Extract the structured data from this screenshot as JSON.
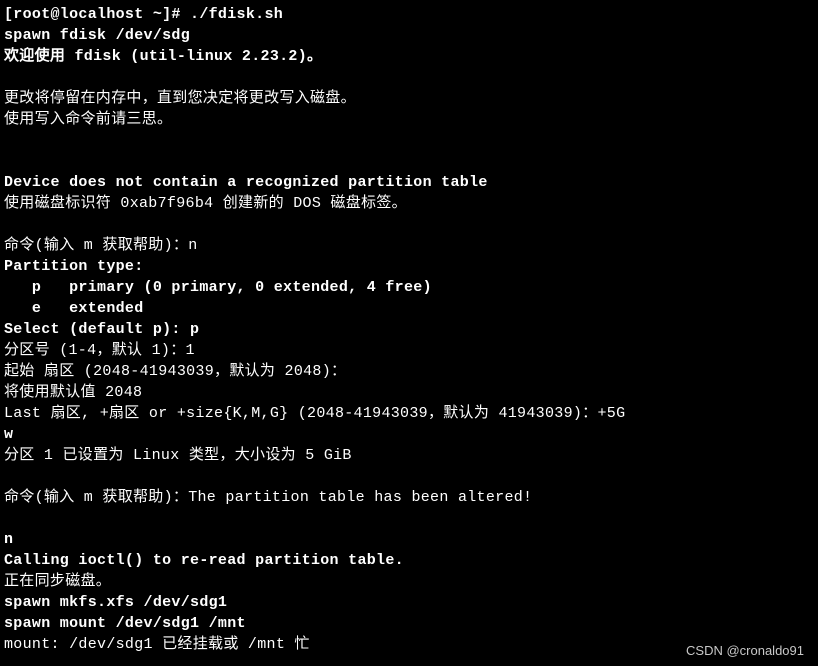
{
  "terminal": {
    "lines": [
      {
        "text": "[root@localhost ~]# ./fdisk.sh",
        "bold": true
      },
      {
        "text": "spawn fdisk /dev/sdg",
        "bold": true
      },
      {
        "text": "欢迎使用 fdisk (util-linux 2.23.2)。",
        "bold": true
      },
      {
        "text": "",
        "bold": false
      },
      {
        "text": "更改将停留在内存中，直到您决定将更改写入磁盘。",
        "bold": false
      },
      {
        "text": "使用写入命令前请三思。",
        "bold": false
      },
      {
        "text": "",
        "bold": false
      },
      {
        "text": "",
        "bold": false
      },
      {
        "text": "Device does not contain a recognized partition table",
        "bold": true
      },
      {
        "text": "使用磁盘标识符 0xab7f96b4 创建新的 DOS 磁盘标签。",
        "bold": false
      },
      {
        "text": "",
        "bold": false
      },
      {
        "text": "命令(输入 m 获取帮助)：n",
        "bold": false
      },
      {
        "text": "Partition type:",
        "bold": true
      },
      {
        "text": "   p   primary (0 primary, 0 extended, 4 free)",
        "bold": true
      },
      {
        "text": "   e   extended",
        "bold": true
      },
      {
        "text": "Select (default p): p",
        "bold": true
      },
      {
        "text": "分区号 (1-4，默认 1)：1",
        "bold": false
      },
      {
        "text": "起始 扇区 (2048-41943039，默认为 2048)：",
        "bold": false
      },
      {
        "text": "将使用默认值 2048",
        "bold": false
      },
      {
        "text": "Last 扇区, +扇区 or +size{K,M,G} (2048-41943039，默认为 41943039)：+5G",
        "bold": false
      },
      {
        "text": "w",
        "bold": true
      },
      {
        "text": "分区 1 已设置为 Linux 类型，大小设为 5 GiB",
        "bold": false
      },
      {
        "text": "",
        "bold": false
      },
      {
        "text": "命令(输入 m 获取帮助)：The partition table has been altered!",
        "bold": false
      },
      {
        "text": "",
        "bold": false
      },
      {
        "text": "n",
        "bold": true
      },
      {
        "text": "Calling ioctl() to re-read partition table.",
        "bold": true
      },
      {
        "text": "正在同步磁盘。",
        "bold": false
      },
      {
        "text": "spawn mkfs.xfs /dev/sdg1",
        "bold": true
      },
      {
        "text": "spawn mount /dev/sdg1 /mnt",
        "bold": true
      },
      {
        "text": "mount: /dev/sdg1 已经挂载或 /mnt 忙",
        "bold": false
      }
    ]
  },
  "watermark": "CSDN @cronaldo91"
}
